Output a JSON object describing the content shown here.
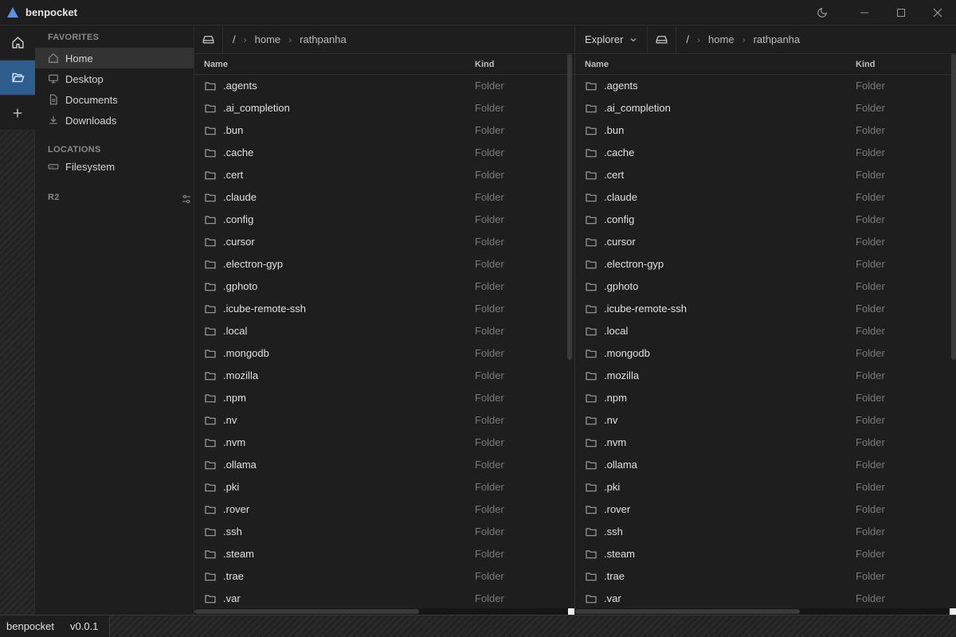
{
  "app": {
    "title": "benpocket",
    "logo_icon": "triangle-logo-icon",
    "accent": "#4a90e2"
  },
  "rail": {
    "items": [
      {
        "icon": "home-icon"
      },
      {
        "icon": "folder-open-icon",
        "active": true
      },
      {
        "icon": "plus-icon"
      }
    ]
  },
  "sidebar": {
    "favorites_label": "FAVORITES",
    "favorites": [
      {
        "label": "Home",
        "icon": "home-icon",
        "active": true
      },
      {
        "label": "Desktop",
        "icon": "monitor-icon"
      },
      {
        "label": "Documents",
        "icon": "document-icon"
      },
      {
        "label": "Downloads",
        "icon": "download-icon"
      }
    ],
    "locations_label": "LOCATIONS",
    "locations": [
      {
        "label": "Filesystem",
        "icon": "drive-icon"
      }
    ],
    "r2_label": "R2"
  },
  "left_pane": {
    "path": [
      "/",
      "home",
      "rathpanha"
    ],
    "col_name": "Name",
    "col_kind": "Kind"
  },
  "right_pane": {
    "view_label": "Explorer",
    "path": [
      "/",
      "home",
      "rathpanha"
    ],
    "col_name": "Name",
    "col_kind": "Kind"
  },
  "files": [
    {
      "name": ".agents",
      "kind": "Folder"
    },
    {
      "name": ".ai_completion",
      "kind": "Folder"
    },
    {
      "name": ".bun",
      "kind": "Folder"
    },
    {
      "name": ".cache",
      "kind": "Folder"
    },
    {
      "name": ".cert",
      "kind": "Folder"
    },
    {
      "name": ".claude",
      "kind": "Folder"
    },
    {
      "name": ".config",
      "kind": "Folder"
    },
    {
      "name": ".cursor",
      "kind": "Folder"
    },
    {
      "name": ".electron-gyp",
      "kind": "Folder"
    },
    {
      "name": ".gphoto",
      "kind": "Folder"
    },
    {
      "name": ".icube-remote-ssh",
      "kind": "Folder"
    },
    {
      "name": ".local",
      "kind": "Folder"
    },
    {
      "name": ".mongodb",
      "kind": "Folder"
    },
    {
      "name": ".mozilla",
      "kind": "Folder"
    },
    {
      "name": ".npm",
      "kind": "Folder"
    },
    {
      "name": ".nv",
      "kind": "Folder"
    },
    {
      "name": ".nvm",
      "kind": "Folder"
    },
    {
      "name": ".ollama",
      "kind": "Folder"
    },
    {
      "name": ".pki",
      "kind": "Folder"
    },
    {
      "name": ".rover",
      "kind": "Folder"
    },
    {
      "name": ".ssh",
      "kind": "Folder"
    },
    {
      "name": ".steam",
      "kind": "Folder"
    },
    {
      "name": ".trae",
      "kind": "Folder"
    },
    {
      "name": ".var",
      "kind": "Folder"
    }
  ],
  "status": {
    "app_name": "benpocket",
    "version": "v0.0.1"
  }
}
